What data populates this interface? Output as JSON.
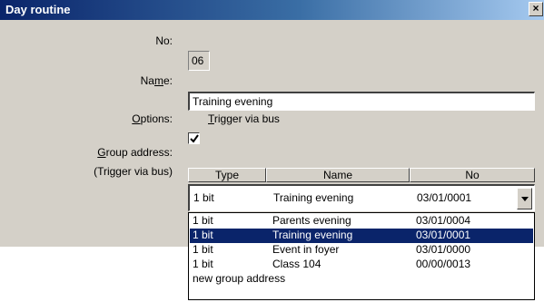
{
  "window": {
    "title": "Day routine",
    "close_label": "×"
  },
  "form": {
    "no_label": "No:",
    "no_value": "06",
    "name_label_pre": "Na",
    "name_label_u": "m",
    "name_label_post": "e:",
    "name_value": "Training evening",
    "options_label_u": "O",
    "options_label_post": "ptions:",
    "trigger_checked": true,
    "trigger_label_u": "T",
    "trigger_label_post": "rigger via bus",
    "group_label_u": "G",
    "group_label_post": "roup address:",
    "group_sublabel": "(Trigger via bus)"
  },
  "grid": {
    "columns": [
      "Type",
      "Name",
      "No"
    ],
    "selected": {
      "type": "1 bit",
      "name": "Training evening",
      "no": "03/01/0001"
    },
    "dropdown_items": [
      {
        "type": "1 bit",
        "name": "Parents evening",
        "no": "03/01/0004",
        "selected": false
      },
      {
        "type": "1 bit",
        "name": "Training evening",
        "no": "03/01/0001",
        "selected": true
      },
      {
        "type": "1 bit",
        "name": "Event in foyer",
        "no": "03/01/0000",
        "selected": false
      },
      {
        "type": "1 bit",
        "name": "Class 104",
        "no": "00/00/0013",
        "selected": false
      }
    ],
    "new_item_label": "new group address"
  },
  "colors": {
    "title_start": "#0a246a",
    "title_end": "#a6caf0",
    "face": "#d4d0c8",
    "highlight": "#0a246a"
  },
  "icons": {
    "close": "close-icon",
    "checkmark": "checkmark-icon",
    "dropdown": "chevron-down-icon"
  }
}
